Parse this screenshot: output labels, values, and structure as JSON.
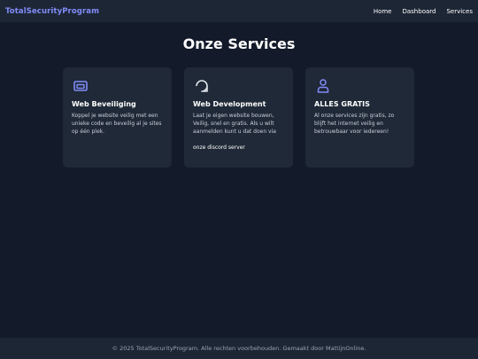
{
  "navbar": {
    "brand": "TotalSecurityProgram",
    "links": [
      "Home",
      "Dashboard",
      "Services"
    ]
  },
  "main": {
    "title": "Onze Services",
    "cards": [
      {
        "icon": "card-icon",
        "title": "Web Beveiliging",
        "text": "Koppel je website veilig met een unieke code en beveilig al je sites op één plek."
      },
      {
        "icon": "chat-bubble-icon",
        "title": "Web Development",
        "text": "Laat je eigen website bouwen, Veilig, snel en gratis. Als u wilt aanmelden kunt u dat doen via",
        "link": "onze discord server"
      },
      {
        "icon": "user-icon",
        "title": "ALLES GRATIS",
        "text": "Al onze services zijn gratis, zo blijft het internet veilig en betrouwbaar voor iedereen!"
      }
    ]
  },
  "footer": {
    "text": "© 2025 TotalSecurityProgram. Alle rechten voorbehouden. Gemaakt door MattijnOnline."
  },
  "colors": {
    "background": "#131a2a",
    "navbar": "#1d2635",
    "card": "#1f2937",
    "accent": "#818cf8"
  }
}
